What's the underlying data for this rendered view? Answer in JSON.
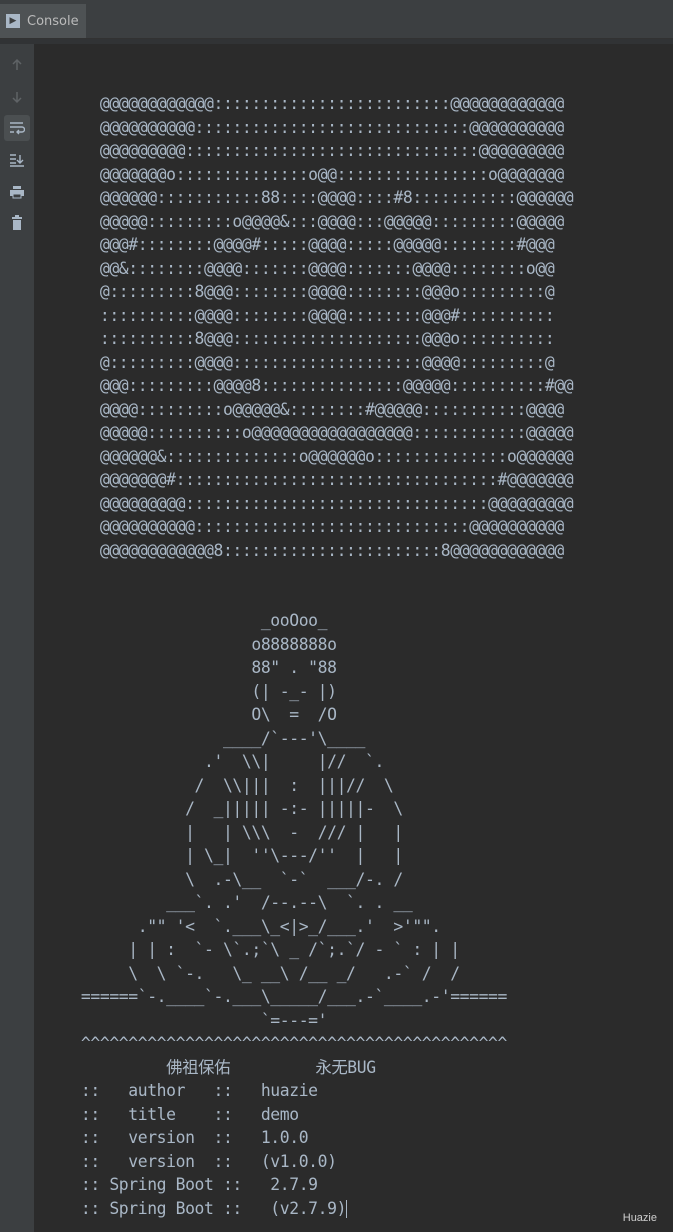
{
  "tab": {
    "label": "Console"
  },
  "toolbar": {
    "items": [
      {
        "icon": "arrow-up-icon"
      },
      {
        "icon": "arrow-down-icon"
      },
      {
        "icon": "soft-wrap-icon"
      },
      {
        "icon": "scroll-to-end-icon"
      },
      {
        "icon": "print-icon"
      },
      {
        "icon": "trash-icon"
      }
    ]
  },
  "console": {
    "ascii_art": "    @@@@@@@@@@@@:::::::::::::::::::::::::@@@@@@@@@@@@\n    @@@@@@@@@@:::::::::::::::::::::::::::::@@@@@@@@@@\n    @@@@@@@@@:::::::::::::::::::::::::::::::@@@@@@@@@\n    @@@@@@@o::::::::::::::o@@::::::::::::::::o@@@@@@@\n    @@@@@@:::::::::::88::::@@@@::::#8:::::::::::@@@@@@\n    @@@@@:::::::::o@@@@&:::@@@@:::@@@@@:::::::::@@@@@\n    @@@#::::::::@@@@#:::::@@@@:::::@@@@@::::::::#@@@\n    @@&::::::::@@@@:::::::@@@@:::::::@@@@::::::::o@@\n    @:::::::::8@@@::::::::@@@@::::::::@@@o:::::::::@\n    ::::::::::@@@@::::::::@@@@::::::::@@@#::::::::::\n    ::::::::::8@@@::::::::::::::::::::@@@o::::::::::\n    @:::::::::@@@@::::::::::::::::::::@@@@:::::::::@\n    @@@:::::::::@@@@8:::::::::::::::@@@@@::::::::::#@@\n    @@@@:::::::::o@@@@@&::::::::#@@@@@:::::::::::@@@@\n    @@@@@::::::::::o@@@@@@@@@@@@@@@@@::::::::::::@@@@@\n    @@@@@@&::::::::::::::o@@@@@@o::::::::::::::o@@@@@@\n    @@@@@@@#::::::::::::::::::::::::::::::::::#@@@@@@@\n    @@@@@@@@@::::::::::::::::::::::::::::::::@@@@@@@@@\n    @@@@@@@@@@:::::::::::::::::::::::::::::@@@@@@@@@@\n    @@@@@@@@@@@@8:::::::::::::::::::::::8@@@@@@@@@@@@\n\n\n                     _ooOoo_\n                    o8888888o\n                    88\" . \"88\n                    (| -_- |)\n                    O\\  =  /O\n                 ____/`---'\\____\n               .'  \\\\|     |//  `.\n              /  \\\\|||  :  |||//  \\\n             /  _||||| -:- |||||-  \\\n             |   | \\\\\\  -  /// |   |\n             | \\_|  ''\\---/''  |   |\n             \\  .-\\__  `-`  ___/-. /\n           ___`. .'  /--.--\\  `. . __\n        .\"\" '<  `.___\\_<|>_/___.'  >'\"\".\n       | | :  `- \\`.;`\\ _ /`;.`/ - ` : | |\n       \\  \\ `-.   \\_ __\\ /__ _/   .-` /  /\n  ======`-.____`-.___\\_____/___.-`____.-'======\n                     `=---='\n  ^^^^^^^^^^^^^^^^^^^^^^^^^^^^^^^^^^^^^^^^^^^^^",
    "blessing": "           佛祖保佑         永无BUG",
    "info_lines": [
      "  ::   author   ::   huazie",
      "  ::   title    ::   demo",
      "  ::   version  ::   1.0.0",
      "  ::   version  ::   (v1.0.0)",
      "  :: Spring Boot ::   2.7.9",
      "  :: Spring Boot ::   (v2.7.9)"
    ]
  },
  "watermark": "Huazie",
  "colors": {
    "text": "#a9b7c6",
    "background": "#2b2b2b",
    "toolbar": "#3c3f41"
  }
}
